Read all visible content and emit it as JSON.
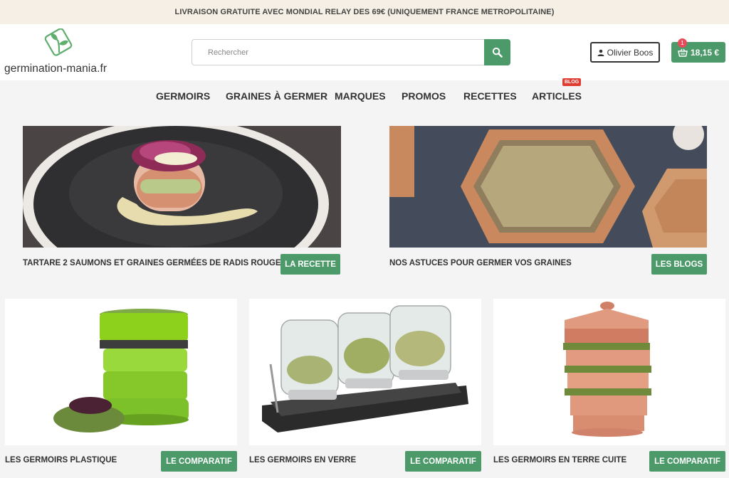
{
  "topbar": {
    "text": "LIVRAISON GRATUITE AVEC MONDIAL RELAY DES 69€ (UNIQUEMENT FRANCE METROPOLITAINE)"
  },
  "header": {
    "logo_text": "germination-mania.fr",
    "search_placeholder": "Rechercher",
    "user_name": "Olivier Boos",
    "cart_total": "18,15 €",
    "cart_count": "1"
  },
  "nav": {
    "items": [
      "GERMOIRS",
      "GRAINES À GERMER",
      "MARQUES",
      "PROMOS",
      "RECETTES",
      "ARTICLES"
    ],
    "articles_badge": "BLOG"
  },
  "banners": [
    {
      "caption": "TARTARE 2 SAUMONS ET GRAINES GERMÉES DE RADIS ROUGE",
      "button": "LA RECETTE"
    },
    {
      "caption": "NOS ASTUCES POUR GERMER VOS GRAINES",
      "button": "LES BLOGS"
    }
  ],
  "cards": [
    {
      "caption": "LES GERMOIRS PLASTIQUE",
      "button": "LE COMPARATIF"
    },
    {
      "caption": "LES GERMOIRS EN VERRE",
      "button": "LE COMPARATIF"
    },
    {
      "caption": "LES GERMOIRS EN TERRE CUITE",
      "button": "LE COMPARATIF"
    }
  ],
  "colors": {
    "accent": "#4c9a6a",
    "topbar_bg": "#f6efe5",
    "badge": "#e03c31"
  }
}
